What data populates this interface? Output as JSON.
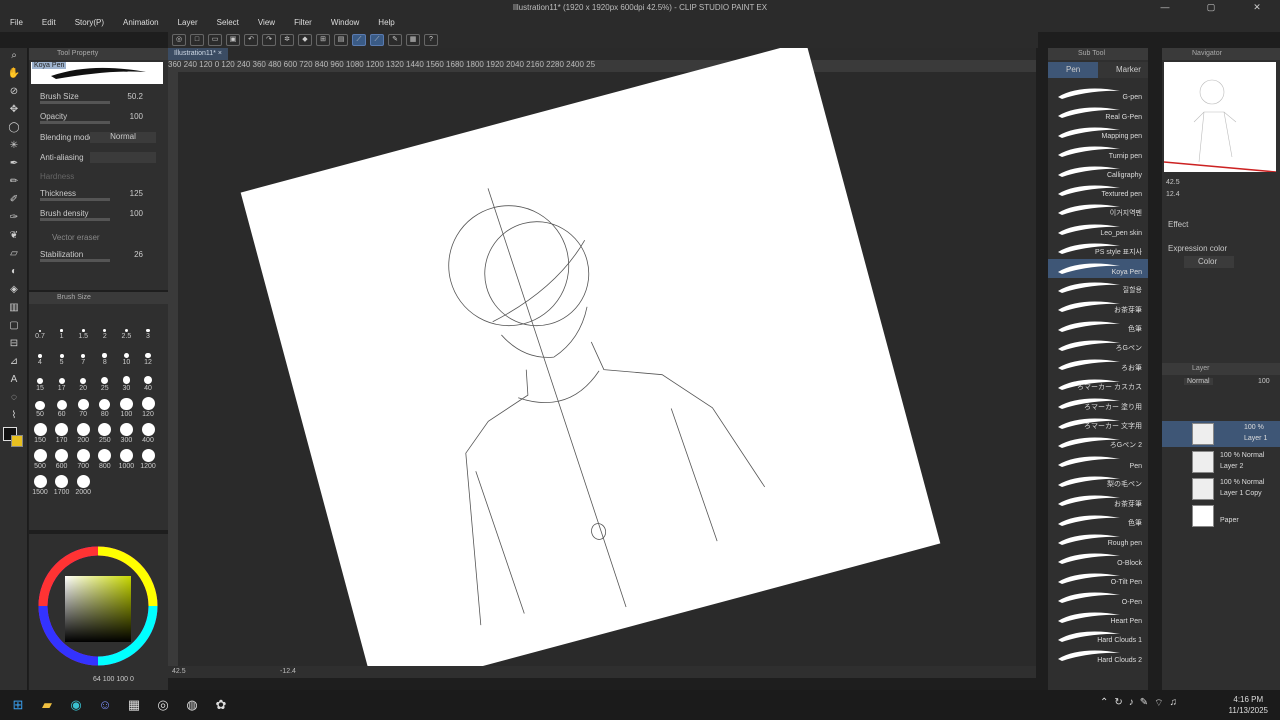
{
  "window": {
    "title": "Illustration11* (1920 x 1920px 600dpi 42.5%) - CLIP STUDIO PAINT EX",
    "minimize": "—",
    "maximize": "▢",
    "close": "✕"
  },
  "menu": [
    "File",
    "Edit",
    "Story(P)",
    "Animation",
    "Layer",
    "Select",
    "View",
    "Filter",
    "Window",
    "Help"
  ],
  "doc_tab": "Illustration11* ×",
  "ruler_text": "360  240  120  0  120  240  360  480  600  720  840  960  1080  1200  1320  1440  1560  1680  1800  1920  2040  2160  2280  2400  25",
  "tool_property": {
    "title": "Tool Property",
    "tool_name": "Koya Pen",
    "brush_size_label": "Brush Size",
    "brush_size_value": "50.2",
    "opacity_label": "Opacity",
    "opacity_value": "100",
    "blending_label": "Blending mode",
    "blending_value": "Normal",
    "antialias_label": "Anti-aliasing",
    "hardness_label": "Hardness",
    "thickness_label": "Thickness",
    "thickness_value": "125",
    "density_label": "Brush density",
    "density_value": "100",
    "vector_eraser_label": "Vector eraser",
    "stabilization_label": "Stabilization",
    "stabilization_value": "26"
  },
  "brush_size_panel": {
    "title": "Brush Size",
    "sizes": [
      "0.7",
      "1",
      "1.5",
      "2",
      "2.5",
      "3",
      "4",
      "5",
      "7",
      "8",
      "10",
      "12",
      "15",
      "17",
      "20",
      "25",
      "30",
      "40",
      "50",
      "60",
      "70",
      "80",
      "100",
      "120",
      "150",
      "170",
      "200",
      "250",
      "300",
      "400",
      "500",
      "600",
      "700",
      "800",
      "1000",
      "1200",
      "1500",
      "1700",
      "2000"
    ]
  },
  "color_readout": "64  100  100  0",
  "status": {
    "zoom": "42.5",
    "angle": "-12.4"
  },
  "sub_tool": {
    "title": "Sub Tool",
    "tabs": [
      "Pen",
      "Marker"
    ],
    "items": [
      "G-pen",
      "Real G-Pen",
      "Mapping pen",
      "Turnip pen",
      "Calligraphy",
      "Textured pen",
      "이거지역펜",
      "Leo_pen skin",
      "PS style 표지사",
      "Koya Pen",
      "질할용",
      "お茶芽筆",
      "色筆",
      "ろGペン",
      "ろお筆",
      "ろマーカー カスカス",
      "ろマーカー 塗り用",
      "ろマーカー 文字用",
      "ろGペン 2",
      "Pen",
      "梨の毛ペン",
      "お茶芽筆",
      "色筆",
      "Rough pen",
      "O-Block",
      "O-Tilt Pen",
      "O-Pen",
      "Heart Pen",
      "Hard Clouds 1",
      "Hard Clouds 2"
    ],
    "selected_index": 9
  },
  "navigator": {
    "title": "Navigator",
    "zoom": "42.5",
    "angle": "12.4"
  },
  "effect": {
    "title": "Effect",
    "expression_label": "Expression color",
    "expression_value": "Color"
  },
  "layer_panel": {
    "title": "Layer",
    "blend": "Normal",
    "opacity": "100",
    "layers": [
      {
        "l1": "100 %",
        "l2": "Layer 1"
      },
      {
        "l1": "100 % Normal",
        "l2": "Layer 2"
      },
      {
        "l1": "100 % Normal",
        "l2": "Layer 1 Copy"
      },
      {
        "l1": "",
        "l2": "Paper"
      }
    ]
  },
  "taskbar": {
    "time": "4:16 PM",
    "date": "11/13/2025"
  }
}
